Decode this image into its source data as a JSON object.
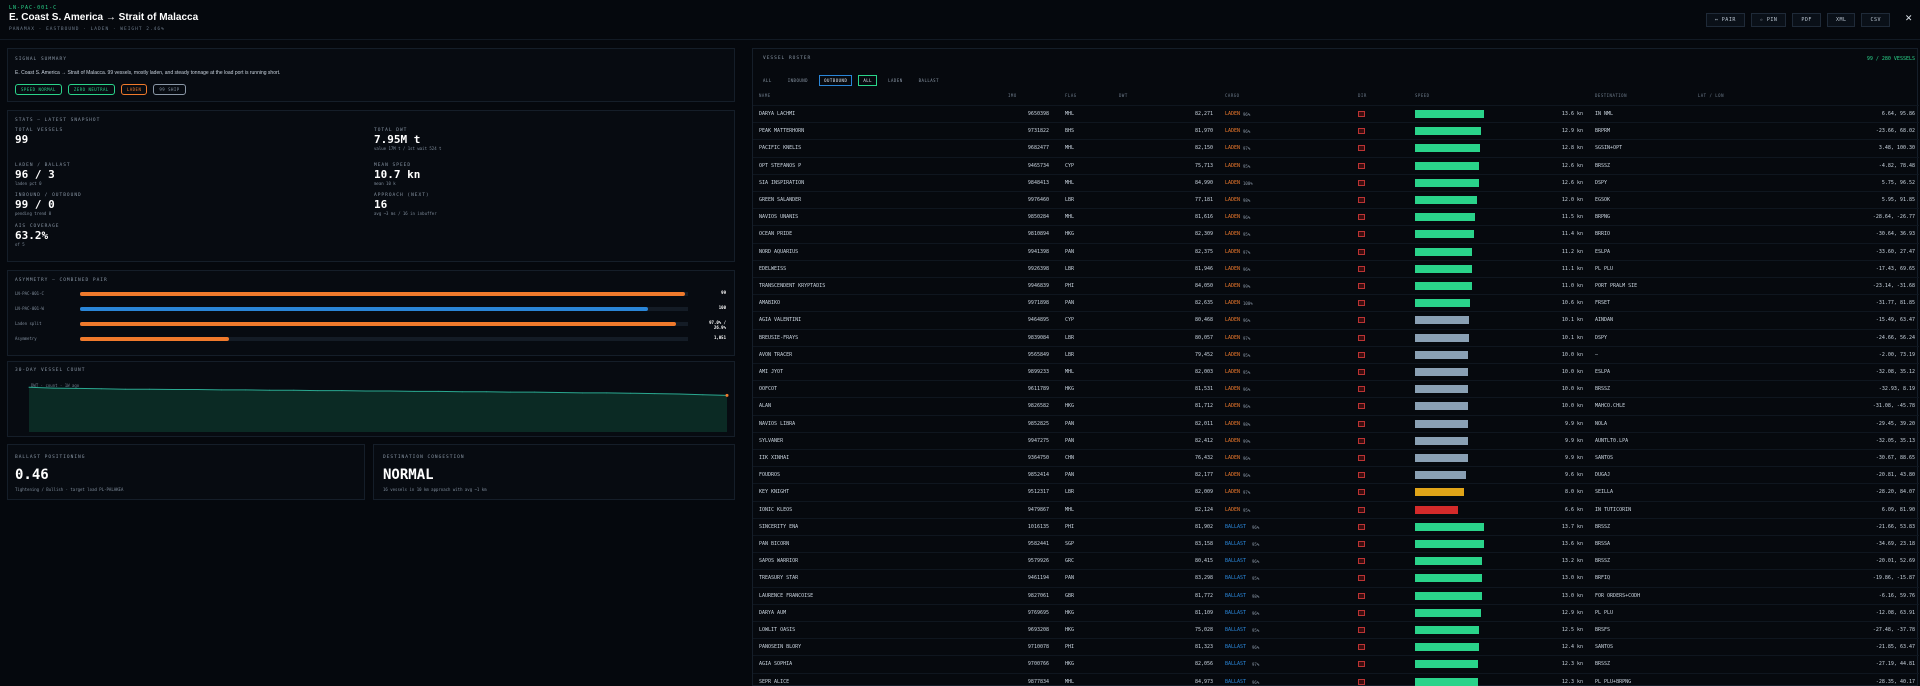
{
  "header": {
    "code": "LN-PAC-001-C",
    "title": "E. Coast S. America → Strait of Malacca",
    "subtitle": "PANAMAX · EASTBOUND · LADEN · WEIGHT 2.46%",
    "buttons": [
      "⇔ PAIR",
      "☆ PIN",
      "PDF",
      "XML",
      "CSV"
    ]
  },
  "signal_summary": {
    "label": "SIGNAL SUMMARY",
    "text": "E. Coast S. America → Strait of Malacca. 99 vessels, mostly laden, and steady tonnage at the load port is running short.",
    "pills": [
      {
        "text": "SPEED NORMAL",
        "color": "#2ad38a"
      },
      {
        "text": "ZERO NEUTRAL",
        "color": "#2ad38a"
      },
      {
        "text": "LADEN",
        "color": "#f07a2c"
      },
      {
        "text": "99 SHIP",
        "color": "#8a97a6"
      }
    ]
  },
  "stats": {
    "label": "STATS — LATEST SNAPSHOT",
    "items": [
      {
        "label": "TOTAL VESSELS",
        "value": "99",
        "note": ""
      },
      {
        "label": "TOTAL DWT",
        "value": "7.95M t",
        "note": "value 17M t / 1st wait 524 t"
      },
      {
        "label": "LADEN / BALLAST",
        "value": "96 / 3",
        "note": "laden pct 0"
      },
      {
        "label": "MEAN SPEED",
        "value": "10.7 kn",
        "note": "mean 10 k"
      },
      {
        "label": "INBOUND / OUTBOUND",
        "value": "99 / 0",
        "note": "pending trend 0"
      },
      {
        "label": "APPROACH (NEXT)",
        "value": "16",
        "note": "avg ~3 ms / 16 in inbuffer"
      },
      {
        "label": "AIS COVERAGE",
        "value": "63.2%",
        "note": "of 5"
      }
    ]
  },
  "asymmetry": {
    "label": "ASYMMETRY — COMBINED PAIR",
    "rows": [
      {
        "name": "LN-PAC-001-C",
        "fill": 0.995,
        "color": "#f07a2c",
        "value": "99"
      },
      {
        "name": "LN-PAC-001-W",
        "fill": 0.935,
        "color": "#2a86d8",
        "value": "100"
      },
      {
        "name": "Laden split",
        "fill": 0.98,
        "color": "#f07a2c",
        "value": "97.0% / 26.9%"
      },
      {
        "name": "Asymmetry",
        "fill": 0.245,
        "color": "#f07a2c",
        "value": "1,051"
      }
    ]
  },
  "chart": {
    "label": "30-DAY VESSEL COUNT",
    "legend": "DWT · count · 1W ago",
    "chart_data": {
      "type": "area",
      "values": [
        121,
        119,
        118,
        117,
        116,
        116,
        115,
        115,
        114,
        114,
        113,
        113,
        112,
        112,
        111,
        111,
        110,
        110,
        109,
        109,
        108,
        108,
        107,
        106,
        106,
        105,
        104,
        103,
        101,
        99
      ],
      "ylim": [
        0,
        130
      ]
    }
  },
  "ballast": {
    "label": "BALLAST POSITIONING",
    "value": "0.46",
    "note": "Tightening / Bullish · target load PL-PALAKEA"
  },
  "dest": {
    "label": "DESTINATION CONGESTION",
    "value": "NORMAL",
    "note": "16 vessels in 10 km approach with avg ~1 km"
  },
  "table": {
    "label": "VESSEL ROSTER",
    "count": "99 / 280 VESSELS",
    "filters": [
      {
        "text": "ALL",
        "on": false
      },
      {
        "text": "INBOUND",
        "on": false
      },
      {
        "text": "OUTBOUND",
        "on": true
      },
      {
        "text": "ALL",
        "on": true
      },
      {
        "text": "LADEN",
        "on": false
      },
      {
        "text": "BALLAST",
        "on": false
      }
    ],
    "headers": [
      "NAME",
      "IMO",
      "FLAG",
      "DWT",
      "CARGO",
      "DIR",
      "SPEED",
      "DESTINATION",
      "LAT / LON"
    ],
    "rows": [
      [
        "DARYA LACHMI",
        "9650398",
        "MHL",
        "82,271",
        "LADEN",
        "2",
        "13.6 kn",
        "IN NML",
        "6.64, 95.86"
      ],
      [
        "PEAK MATTERHORN",
        "9731822",
        "BHS",
        "81,970",
        "LADEN",
        "2",
        "12.9 kn",
        "BRPRM",
        "-23.66, 68.02"
      ],
      [
        "PACIFIC KNELIS",
        "9682477",
        "MHL",
        "82,150",
        "LADEN",
        "2",
        "12.8 kn",
        "SGSIN+OPT",
        "3.48, 100.30"
      ],
      [
        "OPT STEFANOS P",
        "9465734",
        "CYP",
        "75,713",
        "LADEN",
        "2",
        "12.6 kn",
        "BRSSZ",
        "-4.82, 78.48"
      ],
      [
        "SIA INSPIRATION",
        "9848413",
        "MHL",
        "84,990",
        "LADEN",
        "2",
        "12.6 kn",
        "DSPY",
        "5.75, 96.52"
      ],
      [
        "GREEN SALANDER",
        "9976460",
        "LBR",
        "77,181",
        "LADEN",
        "2",
        "12.0 kn",
        "EGSOK",
        "5.95, 91.85"
      ],
      [
        "NAVIOS UNANIS",
        "9850284",
        "MHL",
        "81,616",
        "LADEN",
        "2",
        "11.5 kn",
        "BRPNG",
        "-28.64, -26.77"
      ],
      [
        "OCEAN PRIDE",
        "9810894",
        "HKG",
        "82,309",
        "LADEN",
        "2",
        "11.4 kn",
        "BRRIO",
        "-30.64, 36.93"
      ],
      [
        "NORD AQUARIUS",
        "9941398",
        "PAN",
        "82,375",
        "LADEN",
        "2",
        "11.2 kn",
        "ESLPA",
        "-33.60, 27.47"
      ],
      [
        "EDELWEISS",
        "9926398",
        "LBR",
        "81,946",
        "LADEN",
        "2",
        "11.1 kn",
        "PL PLU",
        "-17.43, 69.65"
      ],
      [
        "TRANSCENDENT KRYPTADIS",
        "9946839",
        "PHI",
        "84,050",
        "LADEN",
        "2",
        "11.0 kn",
        "PORT PRALM SIE",
        "-23.14, -31.68"
      ],
      [
        "AMABIKO",
        "9971898",
        "PAN",
        "82,635",
        "LADEN",
        "2",
        "10.6 kn",
        "FRSET",
        "-31.77, 81.85"
      ],
      [
        "AGIA VALENTINI",
        "9464895",
        "CYP",
        "80,468",
        "LADEN",
        "2",
        "10.1 kn",
        "AINDAN",
        "-15.49, 63.47"
      ],
      [
        "BREUSIE-FRAYS",
        "9839084",
        "LBR",
        "80,057",
        "LADEN",
        "2",
        "10.1 kn",
        "DSPY",
        "-24.66, 56.24"
      ],
      [
        "AVON TRACER",
        "9565849",
        "LBR",
        "79,452",
        "LADEN",
        "2",
        "10.0 kn",
        "—",
        "-2.00, 73.19"
      ],
      [
        "AMI JYOT",
        "9899233",
        "MHL",
        "82,003",
        "LADEN",
        "2",
        "10.0 kn",
        "ESLPA",
        "-32.08, 35.12"
      ],
      [
        "OOFCOT",
        "9611789",
        "HKG",
        "81,531",
        "LADEN",
        "2",
        "10.0 kn",
        "BRSSZ",
        "-32.93, 8.19"
      ],
      [
        "ALAN",
        "9826582",
        "HKG",
        "81,712",
        "LADEN",
        "2",
        "10.0 kn",
        "MAHCO.CHLE",
        "-31.08, -45.78"
      ],
      [
        "NAVIOS LIBRA",
        "9852825",
        "PAN",
        "82,011",
        "LADEN",
        "2",
        "9.9 kn",
        "NOLA",
        "-29.45, 39.20"
      ],
      [
        "SYLVANER",
        "9947275",
        "PAN",
        "82,412",
        "LADEN",
        "2",
        "9.9 kn",
        "AUNTLT0.LPA",
        "-32.05, 35.13"
      ],
      [
        "IIK XINHAI",
        "9364750",
        "CHN",
        "76,432",
        "LADEN",
        "2",
        "9.9 kn",
        "SANTOS",
        "-30.67, 88.65"
      ],
      [
        "FOUDROS",
        "9852414",
        "PAN",
        "82,177",
        "LADEN",
        "2",
        "9.6 kn",
        "DUGAJ",
        "-20.81, 43.80"
      ],
      [
        "KEY KNIGHT",
        "9512317",
        "LBR",
        "82,009",
        "LADEN",
        "2",
        "8.0 kn",
        "SEILLA",
        "-28.20, 84.07"
      ],
      [
        "IONIC KLEOS",
        "9479867",
        "MHL",
        "82,124",
        "LADEN",
        "2",
        "6.6 kn",
        "IN TUTICORIN",
        "6.09, 81.90"
      ],
      [
        "SINCERITY ENA",
        "1016135",
        "PHI",
        "81,902",
        "BALLAST",
        "2",
        "13.7 kn",
        "BRSSZ",
        "-21.66, 53.83"
      ],
      [
        "PAN BICORN",
        "9582441",
        "SGP",
        "83,158",
        "BALLAST",
        "2",
        "13.6 kn",
        "BRSSA",
        "-34.69, 23.18"
      ],
      [
        "SAPOS WARRIOR",
        "9579926",
        "GRC",
        "80,415",
        "BALLAST",
        "2",
        "13.2 kn",
        "BRSSZ",
        "-20.01, 52.69"
      ],
      [
        "TREASURY STAR",
        "9461194",
        "PAN",
        "83,298",
        "BALLAST",
        "2",
        "13.0 kn",
        "BRFIQ",
        "-19.86, -15.87"
      ],
      [
        "LAURENCE FRANCOISE",
        "9827061",
        "GBR",
        "81,772",
        "BALLAST",
        "2",
        "13.0 kn",
        "FOR ORDERS+CODH",
        "-6.16, 59.76"
      ],
      [
        "DARYA AUM",
        "9769695",
        "HKG",
        "81,109",
        "BALLAST",
        "2",
        "12.9 kn",
        "PL PLU",
        "-12.08, 63.91"
      ],
      [
        "LOWLIT OASIS",
        "9693208",
        "HKG",
        "75,028",
        "BALLAST",
        "2",
        "12.5 kn",
        "BRSFS",
        "-27.48, -37.78"
      ],
      [
        "PANOSEIN BLORY",
        "9710078",
        "PHI",
        "81,323",
        "BALLAST",
        "2",
        "12.4 kn",
        "SANTOS",
        "-21.85, 63.47"
      ],
      [
        "AGIA SOPHIA",
        "9700766",
        "HKG",
        "82,056",
        "BALLAST",
        "2",
        "12.3 kn",
        "BRSSZ",
        "-27.19, 44.81"
      ],
      [
        "SEPR ALICE",
        "9877834",
        "MHL",
        "84,973",
        "BALLAST",
        "2",
        "12.3 kn",
        "PL PLU+BRPNG",
        "-28.35, 40.17"
      ]
    ],
    "speed_fill": [
      0.98,
      0.94,
      0.93,
      0.92,
      0.92,
      0.88,
      0.85,
      0.84,
      0.82,
      0.81,
      0.81,
      0.78,
      0.77,
      0.77,
      0.76,
      0.76,
      0.76,
      0.76,
      0.75,
      0.75,
      0.75,
      0.73,
      0.7,
      0.62,
      0.99,
      0.98,
      0.96,
      0.95,
      0.95,
      0.94,
      0.92,
      0.91,
      0.9,
      0.9
    ],
    "speed_color": [
      "#2ad38a",
      "#2ad38a",
      "#2ad38a",
      "#2ad38a",
      "#2ad38a",
      "#2ad38a",
      "#2ad38a",
      "#2ad38a",
      "#2ad38a",
      "#2ad38a",
      "#2ad38a",
      "#2ad38a",
      "#8aa0b4",
      "#8aa0b4",
      "#8aa0b4",
      "#8aa0b4",
      "#8aa0b4",
      "#8aa0b4",
      "#8aa0b4",
      "#8aa0b4",
      "#8aa0b4",
      "#8aa0b4",
      "#e0a418",
      "#d42a2a",
      "#2ad38a",
      "#2ad38a",
      "#2ad38a",
      "#2ad38a",
      "#2ad38a",
      "#2ad38a",
      "#2ad38a",
      "#2ad38a",
      "#2ad38a",
      "#2ad38a"
    ],
    "cargo_pct": [
      "96%",
      "96%",
      "97%",
      "95%",
      "100%",
      "98%",
      "96%",
      "95%",
      "97%",
      "96%",
      "99%",
      "100%",
      "96%",
      "97%",
      "95%",
      "95%",
      "96%",
      "96%",
      "98%",
      "99%",
      "96%",
      "96%",
      "97%",
      "95%",
      "96%",
      "95%",
      "96%",
      "95%",
      "98%",
      "96%",
      "95%",
      "96%",
      "97%",
      "96%"
    ]
  },
  "colors": {
    "green": "#2ad38a",
    "orange": "#f07a2c",
    "blue": "#2a86d8"
  }
}
